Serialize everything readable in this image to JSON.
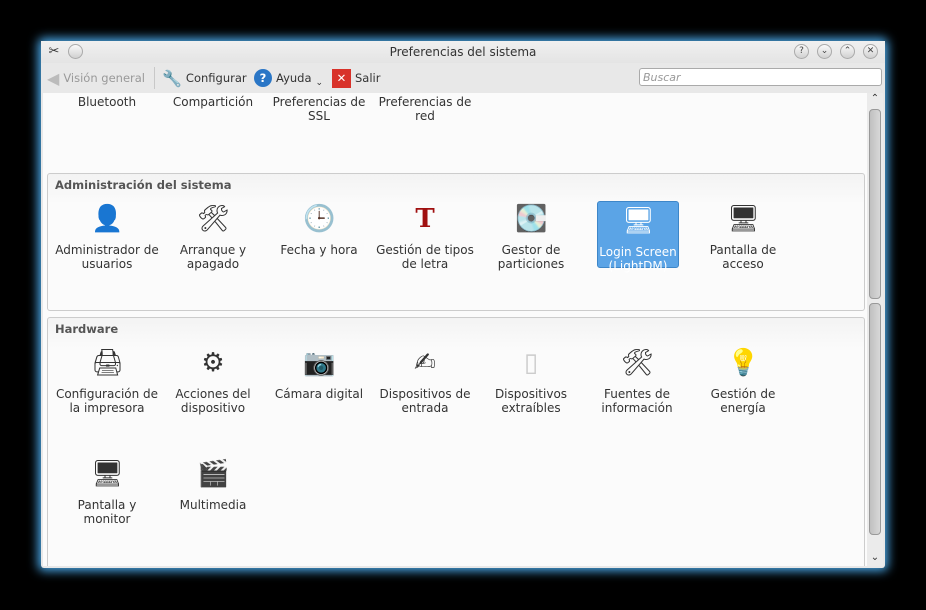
{
  "window": {
    "title": "Preferencias del sistema"
  },
  "toolbar": {
    "back": "Visión general",
    "configure": "Configurar",
    "help": "Ayuda",
    "quit": "Salir",
    "search_placeholder": "Buscar"
  },
  "top_items": [
    "Bluetooth",
    "Compartición",
    "Preferencias de SSL",
    "Preferencias de red"
  ],
  "groups": [
    {
      "title": "Administración del sistema",
      "items": [
        "Administrador de usuarios",
        "Arranque y apagado",
        "Fecha y hora",
        "Gestión de tipos de letra",
        "Gestor de particiones",
        "Login Screen (LightDM)",
        "Pantalla de acceso"
      ],
      "selected": "Login Screen (LightDM)"
    },
    {
      "title": "Hardware",
      "items": [
        "Configuración de la impresora",
        "Acciones del dispositivo",
        "Cámara digital",
        "Dispositivos de entrada",
        "Dispositivos extraíbles",
        "Fuentes de información",
        "Gestión de energía",
        "Pantalla y monitor",
        "Multimedia"
      ]
    }
  ]
}
